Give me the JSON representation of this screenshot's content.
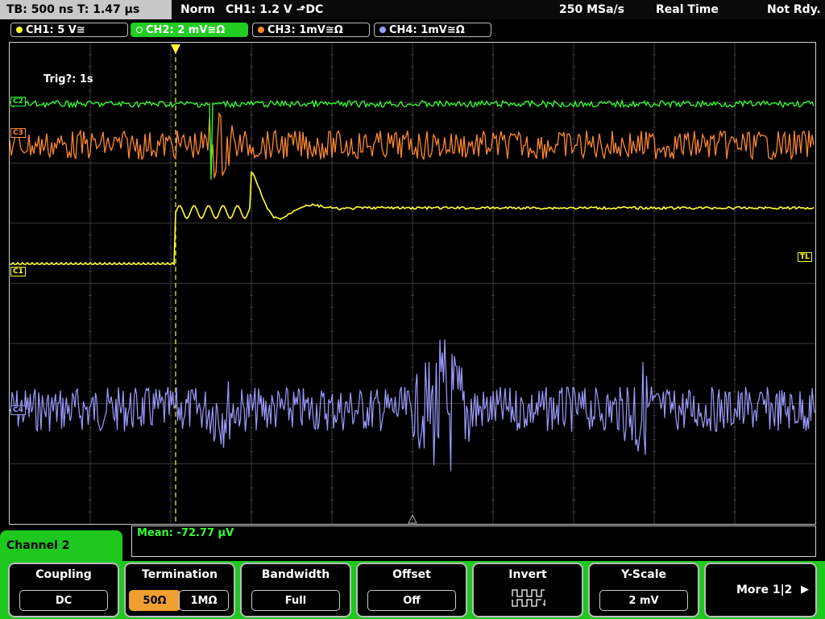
{
  "status": {
    "tb_text": "TB: 500 ns   T: 1.47 µs",
    "mode": "Norm",
    "trigger": "CH1: 1.2 V ⬏DC",
    "sample_rate": "250 MSa/s",
    "acq_mode": "Real Time",
    "ready": "Not Rdy."
  },
  "channels": [
    {
      "label": "CH1: 5 V≅",
      "color": "#ffff33"
    },
    {
      "label": "CH2: 2 mV≅Ω",
      "color": "#33ff33"
    },
    {
      "label": "CH3: 1mV≅Ω",
      "color": "#ff8830"
    },
    {
      "label": "CH4: 1mV≅Ω",
      "color": "#9c9cff"
    }
  ],
  "scope": {
    "trigger_info": "Trig?: 1s",
    "labels": {
      "c1": "C1",
      "c2": "C2",
      "c3": "C3",
      "c4": "C4",
      "tl": "TL"
    }
  },
  "measure": {
    "mean": "Mean: -72.77 µV"
  },
  "menu": {
    "title": "Channel 2",
    "coupling": {
      "title": "Coupling",
      "value": "DC"
    },
    "termination": {
      "title": "Termination",
      "opt1": "50Ω",
      "opt2": "1MΩ"
    },
    "bandwidth": {
      "title": "Bandwidth",
      "value": "Full"
    },
    "offset": {
      "title": "Offset",
      "value": "Off"
    },
    "invert": {
      "title": "Invert"
    },
    "yscale": {
      "title": "Y-Scale",
      "value": "2 mV"
    },
    "more": {
      "label": "More 1|2"
    }
  }
}
